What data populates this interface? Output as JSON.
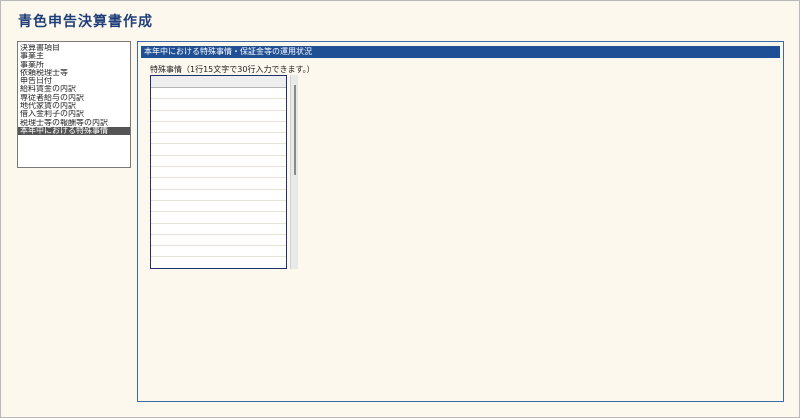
{
  "app": {
    "title": "青色申告決算書作成"
  },
  "sidebar": {
    "items": [
      {
        "label": "決算書項目",
        "selected": false
      },
      {
        "label": "事業主",
        "selected": false
      },
      {
        "label": "事業所",
        "selected": false
      },
      {
        "label": "依頼税理士等",
        "selected": false
      },
      {
        "label": "申告日付",
        "selected": false
      },
      {
        "label": "給料賃金の内訳",
        "selected": false
      },
      {
        "label": "専従者給与の内訳",
        "selected": false
      },
      {
        "label": "地代家賃の内訳",
        "selected": false
      },
      {
        "label": "借入金利子の内訳",
        "selected": false
      },
      {
        "label": "税理士等の報酬等の内訳",
        "selected": false
      },
      {
        "label": "本年中における特殊事情",
        "selected": true
      }
    ]
  },
  "main": {
    "header": "本年中における特殊事情・保証金等の運用状況",
    "field_label": "特殊事情（1行15文字で30行入力できます。）",
    "text_rows": [
      "",
      "",
      "",
      "",
      "",
      "",
      "",
      "",
      "",
      "",
      "",
      "",
      "",
      "",
      "",
      ""
    ]
  },
  "colors": {
    "background": "#fdf8ee",
    "header_bar": "#1f4f95",
    "title_text": "#1f3f7a",
    "selected_item": "#555555"
  }
}
